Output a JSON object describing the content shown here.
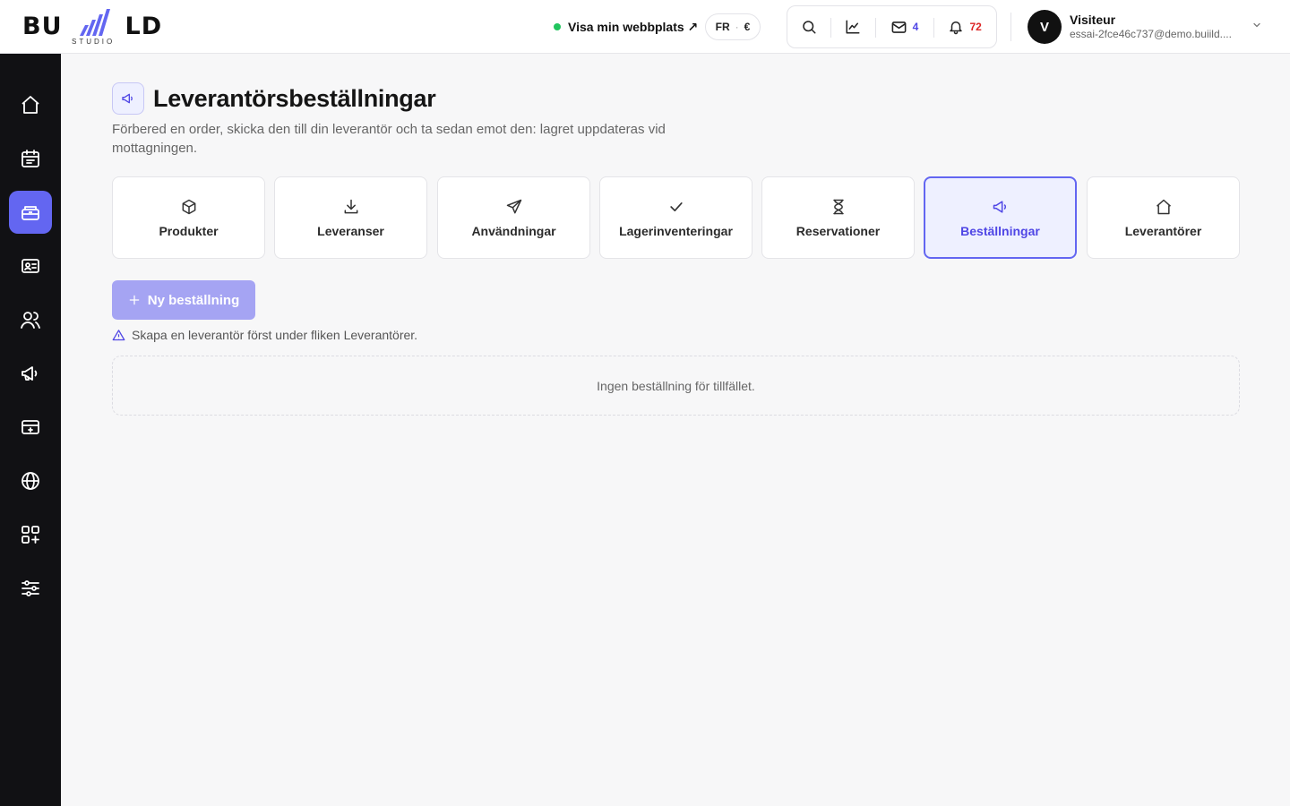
{
  "header": {
    "logo": {
      "word_left": "BU",
      "word_right": "LD",
      "sub": "STUDIO"
    },
    "visit_link": "Visa min webbplats ↗",
    "lang": "FR",
    "currency": "€",
    "mail_count": "4",
    "notif_count": "72",
    "user": {
      "initial": "V",
      "name": "Visiteur",
      "email": "essai-2fce46c737@demo.buiild...."
    }
  },
  "sidebar": {
    "items": [
      {
        "icon": "home-icon"
      },
      {
        "icon": "calendar-icon"
      },
      {
        "icon": "inventory-icon",
        "active": true
      },
      {
        "icon": "contact-card-icon"
      },
      {
        "icon": "users-icon"
      },
      {
        "icon": "megaphone-icon"
      },
      {
        "icon": "payment-card-icon"
      },
      {
        "icon": "globe-icon"
      },
      {
        "icon": "apps-add-icon"
      },
      {
        "icon": "settings-sliders-icon"
      }
    ]
  },
  "page": {
    "title": "Leverantörsbeställningar",
    "description": "Förbered en order, skicka den till din leverantör och ta sedan emot den: lagret uppdateras vid mottagningen."
  },
  "tabs": [
    {
      "label": "Produkter",
      "icon": "box-icon"
    },
    {
      "label": "Leveranser",
      "icon": "download-icon"
    },
    {
      "label": "Användningar",
      "icon": "send-icon"
    },
    {
      "label": "Lagerinventeringar",
      "icon": "check-icon"
    },
    {
      "label": "Reservationer",
      "icon": "hourglass-icon"
    },
    {
      "label": "Beställningar",
      "icon": "megaphone-icon",
      "active": true
    },
    {
      "label": "Leverantörer",
      "icon": "home-icon"
    }
  ],
  "actions": {
    "new_order": "Ny beställning",
    "warning": "Skapa en leverantör först under fliken Leverantörer.",
    "empty_state": "Ingen beställning för tillfället."
  },
  "colors": {
    "accent": "#6366f1",
    "sidebar_bg": "#111114",
    "status_online": "#22c55e",
    "notif": "#dc2626"
  }
}
